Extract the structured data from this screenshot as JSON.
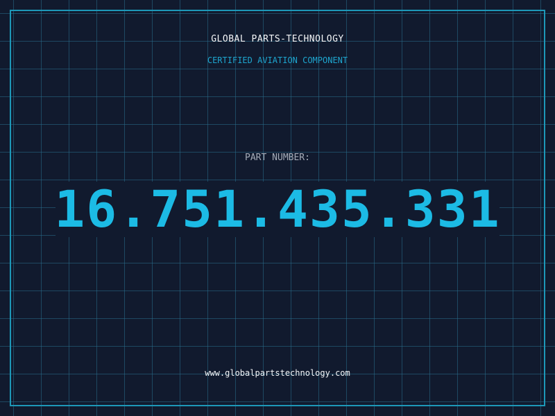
{
  "header": {
    "company": "GLOBAL PARTS-TECHNOLOGY",
    "subtitle": "CERTIFIED AVIATION COMPONENT"
  },
  "part": {
    "label": "PART NUMBER:",
    "number": "16.751.435.331"
  },
  "footer": {
    "url": "www.globalpartstechnology.com"
  },
  "colors": {
    "background": "#111a2e",
    "grid": "#286e8c",
    "accent": "#1cbbe5",
    "frame": "#1d98b8",
    "text": "#f4f6f8",
    "muted": "#a6adb9"
  }
}
